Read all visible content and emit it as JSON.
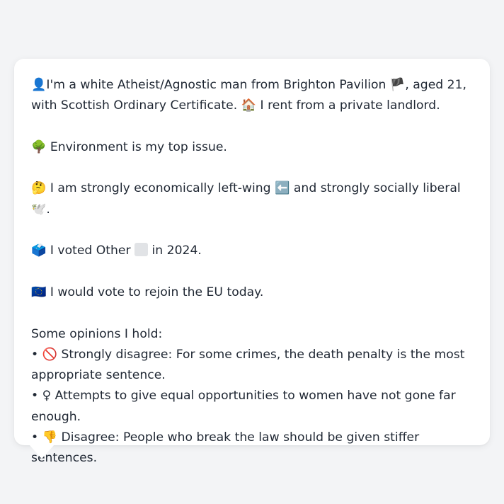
{
  "profile": {
    "line1": {
      "icon": "👤",
      "text_a": "I'm a white Atheist/Agnostic man from Brighton Pavilion ",
      "flag": "🏴",
      "text_b": ", aged 21, with Scottish Ordinary Certificate. ",
      "house_icon": "🏠",
      "text_c": " I rent from a private landlord."
    },
    "line2": {
      "icon": "🌳",
      "text": " Environment is my top issue."
    },
    "line3": {
      "icon": "🤔",
      "text_a": " I am strongly economically left-wing ",
      "arrow_icon": "⬅️",
      "text_b": " and strongly socially liberal ",
      "dove_icon": "🕊️",
      "text_c": "."
    },
    "line4": {
      "icon": "🗳️",
      "text_a": " I voted Other ",
      "text_b": " in 2024."
    },
    "line5": {
      "icon": "🇪🇺",
      "text": " I would vote to rejoin the EU today."
    }
  },
  "opinions": {
    "heading": "Some opinions I hold:",
    "items": [
      {
        "bullet": "• ",
        "icon": "🚫",
        "text": " Strongly disagree: For some crimes, the death penalty is the most appropriate sentence."
      },
      {
        "bullet": "• ",
        "icon": "♀",
        "text": "  Attempts to give equal opportunities to women have not gone far enough."
      },
      {
        "bullet": "• ",
        "icon": "👎",
        "text": " Disagree: People who break the law should be given stiffer sentences."
      }
    ]
  }
}
